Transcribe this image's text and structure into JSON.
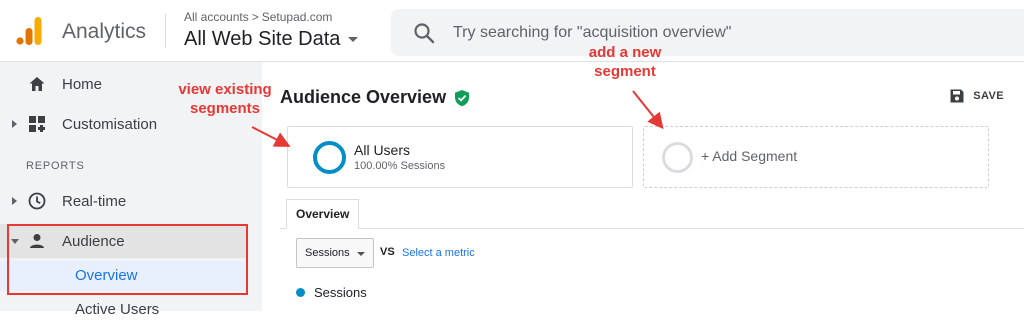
{
  "header": {
    "product_name": "Analytics",
    "breadcrumb": {
      "parent": "All accounts",
      "separator": ">",
      "account": "Setupad.com"
    },
    "view_name": "All Web Site Data",
    "search_placeholder": "Try searching for \"acquisition overview\"",
    "logo_icon": "analytics-logo",
    "search_icon": "search-icon"
  },
  "sidebar": {
    "home": "Home",
    "customisation": "Customisation",
    "reports_heading": "REPORTS",
    "realtime": "Real-time",
    "audience": "Audience",
    "overview": "Overview",
    "active_users": "Active Users"
  },
  "main": {
    "title": "Audience Overview",
    "save_label": "SAVE",
    "segment": {
      "name": "All Users",
      "detail": "100.00% Sessions"
    },
    "add_segment": "+ Add Segment",
    "tab_overview": "Overview",
    "metric_select": "Sessions",
    "vs": "VS",
    "select_metric": "Select a metric",
    "legend_series": "Sessions"
  },
  "annotations": {
    "existing_line1": "view existing",
    "existing_line2": "segments",
    "new_line1": "add a new",
    "new_line2": "segment"
  },
  "colors": {
    "accent_blue": "#1a73e8",
    "segment_blue": "#058dc7",
    "annotation_red": "#e53935",
    "logo_orange": "#f9ab00",
    "logo_dark_orange": "#e37400"
  }
}
